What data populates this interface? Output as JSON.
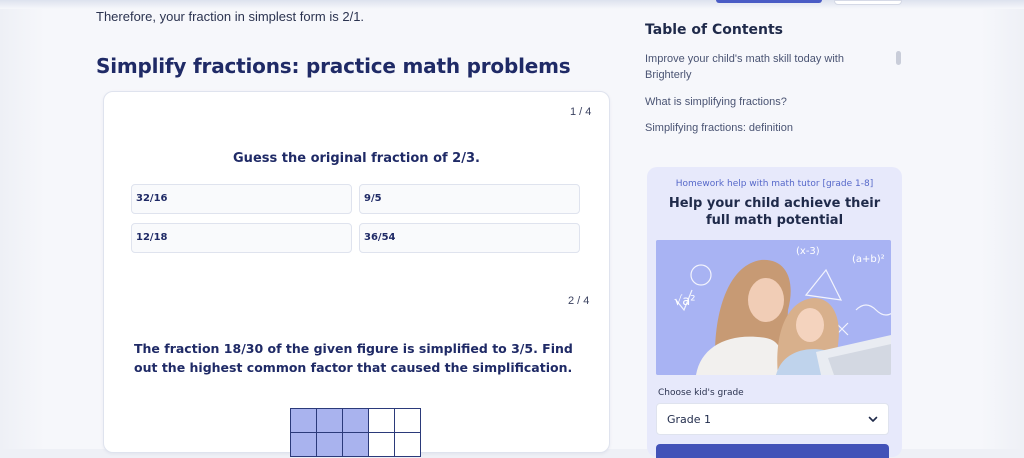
{
  "article": {
    "intro_text": "Therefore, your fraction in simplest form is 2/1.",
    "section_title": "Simplify fractions: practice math problems"
  },
  "quiz": {
    "q1": {
      "counter": "1 / 4",
      "question": "Guess the original fraction of 2/3.",
      "options": [
        "32/16",
        "9/5",
        "12/18",
        "36/54"
      ]
    },
    "q2": {
      "counter": "2 / 4",
      "question": "The fraction 18/30 of the given figure is simplified to 3/5. Find out the highest common factor that caused the simplification.",
      "figure_shaded_first_two_rows": [
        3,
        3
      ]
    }
  },
  "toc": {
    "title": "Table of Contents",
    "items": [
      "Improve your child's math skill today with Brighterly",
      "What is simplifying fractions?",
      "Simplifying fractions: definition"
    ]
  },
  "promo": {
    "subtitle": "Homework help with math tutor [grade 1-8]",
    "title": "Help your child achieve their full math potential",
    "photo_formulas": [
      "(x-3)",
      "(a+b)²",
      "√a²"
    ],
    "grade_label": "Choose kid's grade",
    "grade_value": "Grade 1"
  },
  "colors": {
    "accent": "#4a5cc5",
    "title": "#1f2a66",
    "shaded_cell": "#a9b3ee",
    "promo_bg": "#e7e9fb"
  }
}
